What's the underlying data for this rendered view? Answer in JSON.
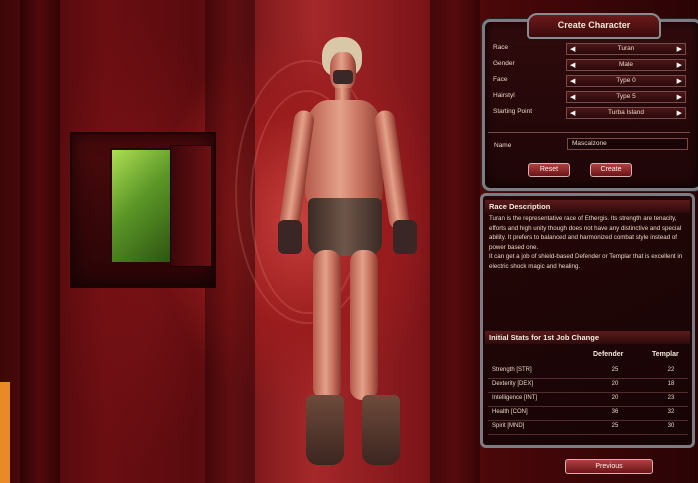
{
  "window": {
    "title": "Create Character"
  },
  "options": [
    {
      "label": "Race",
      "value": "Turan"
    },
    {
      "label": "Gender",
      "value": "Male"
    },
    {
      "label": "Face",
      "value": "Type 0"
    },
    {
      "label": "Hairstyl",
      "value": "Type 5"
    },
    {
      "label": "Starting Point",
      "value": "Turba Island"
    }
  ],
  "name_field": {
    "label": "Name",
    "value": "Mascalzone"
  },
  "buttons": {
    "reset": "Reset",
    "create": "Create",
    "previous": "Previous"
  },
  "race_description": {
    "heading": "Race Description",
    "paragraphs": [
      "Turan is the representative race of Ethergis. Its strength are tenacity, efforts and high unity though does not have any distinctive and special ability. It prefers to balanced and harmonized combat style instead of power based one.",
      "It can get a job of shield-based Defender or Templar that is excellent in electric shock magic and healing."
    ]
  },
  "initial_stats": {
    "heading": "Initial Stats for 1st Job Change",
    "columns": [
      "Defender",
      "Templar"
    ],
    "rows": [
      {
        "label": "Strength [STR]",
        "defender": "25",
        "templar": "22"
      },
      {
        "label": "Dexterity [DEX]",
        "defender": "20",
        "templar": "18"
      },
      {
        "label": "Intelligence [INT]",
        "defender": "20",
        "templar": "23"
      },
      {
        "label": "Health [CON]",
        "defender": "36",
        "templar": "32"
      },
      {
        "label": "Spirit [MND]",
        "defender": "25",
        "templar": "30"
      }
    ]
  }
}
